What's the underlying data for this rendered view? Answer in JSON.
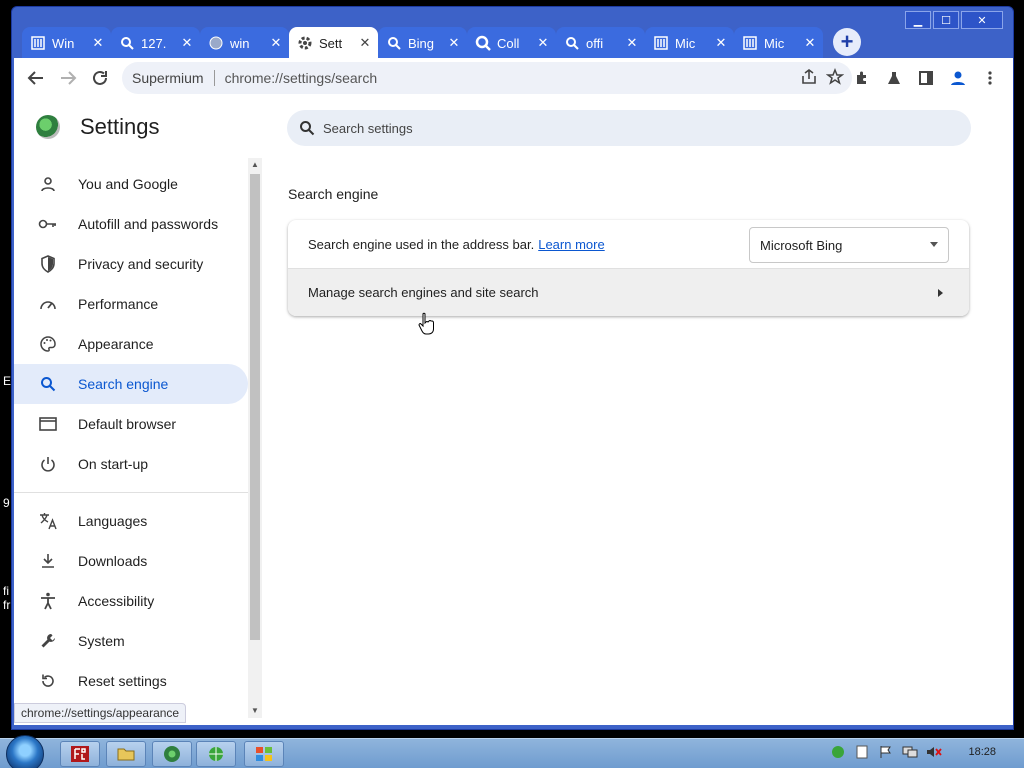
{
  "desktop": {
    "fragments": [
      "E",
      "9",
      "fi",
      "fr"
    ]
  },
  "window": {
    "controls": {
      "minimize": "▁",
      "maximize": "☐",
      "close": "✕"
    }
  },
  "tabs": [
    {
      "title": "Win",
      "icon": "library-icon"
    },
    {
      "title": "127.",
      "icon": "search-icon"
    },
    {
      "title": "win",
      "icon": "globe-icon"
    },
    {
      "title": "Sett",
      "icon": "gear-icon",
      "active": true
    },
    {
      "title": "Bing",
      "icon": "search-icon"
    },
    {
      "title": "Coll",
      "icon": "search-icon"
    },
    {
      "title": "offi",
      "icon": "search-icon"
    },
    {
      "title": "Mic",
      "icon": "library-icon"
    },
    {
      "title": "Mic",
      "icon": "library-icon"
    }
  ],
  "tab_close_glyph": "✕",
  "new_tab_glyph": "+",
  "toolbar": {
    "origin": "Supermium",
    "url": "chrome://settings/search"
  },
  "settings": {
    "title": "Settings",
    "search_placeholder": "Search settings",
    "nav": [
      {
        "label": "You and Google",
        "icon": "person-icon"
      },
      {
        "label": "Autofill and passwords",
        "icon": "key-icon"
      },
      {
        "label": "Privacy and security",
        "icon": "shield-icon"
      },
      {
        "label": "Performance",
        "icon": "speedometer-icon"
      },
      {
        "label": "Appearance",
        "icon": "palette-icon"
      },
      {
        "label": "Search engine",
        "icon": "search-icon",
        "active": true
      },
      {
        "label": "Default browser",
        "icon": "browser-icon"
      },
      {
        "label": "On start-up",
        "icon": "power-icon"
      },
      {
        "label": "Languages",
        "icon": "translate-icon"
      },
      {
        "label": "Downloads",
        "icon": "download-icon"
      },
      {
        "label": "Accessibility",
        "icon": "accessibility-icon"
      },
      {
        "label": "System",
        "icon": "wrench-icon"
      },
      {
        "label": "Reset settings",
        "icon": "reset-icon"
      }
    ],
    "section_title": "Search engine",
    "row1": {
      "text": "Search engine used in the address bar.",
      "link": "Learn more",
      "select_value": "Microsoft Bing"
    },
    "row2": {
      "text": "Manage search engines and site search"
    }
  },
  "status_url": "chrome://settings/appearance",
  "taskbar": {
    "clock": "18:28"
  },
  "colors": {
    "accent": "#0b57d0",
    "active_nav_bg": "#e3ebfa",
    "frame": "#3d62c8"
  }
}
